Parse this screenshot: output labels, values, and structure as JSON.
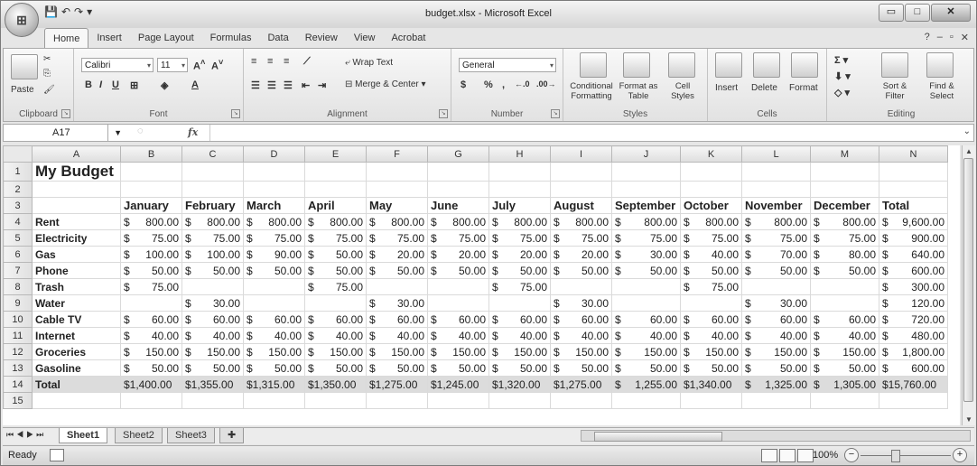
{
  "window": {
    "title": "budget.xlsx - Microsoft Excel",
    "controls": [
      "▭",
      "□",
      "✕"
    ]
  },
  "quick_access": [
    "💾",
    "↶",
    "↷",
    "▾"
  ],
  "ribbon_tabs": [
    "Home",
    "Insert",
    "Page Layout",
    "Formulas",
    "Data",
    "Review",
    "View",
    "Acrobat"
  ],
  "ribbon": {
    "groups": [
      "Clipboard",
      "Font",
      "Alignment",
      "Number",
      "Styles",
      "Cells",
      "Editing"
    ],
    "paste": "Paste",
    "font_name": "Calibri",
    "font_size": "11",
    "wrap_text": "Wrap Text",
    "merge_center": "Merge & Center",
    "number_format": "General",
    "conditional_formatting": "Conditional Formatting",
    "format_as_table": "Format as Table",
    "cell_styles": "Cell Styles",
    "insert": "Insert",
    "delete": "Delete",
    "format": "Format",
    "sort_filter": "Sort & Filter",
    "find_select": "Find & Select",
    "currency": "$",
    "percent": "%",
    "comma": ","
  },
  "formula_bar": {
    "name_box": "A17",
    "formula": ""
  },
  "sheet": {
    "columns": [
      "A",
      "B",
      "C",
      "D",
      "E",
      "F",
      "G",
      "H",
      "I",
      "J",
      "K",
      "L",
      "M",
      "N"
    ],
    "title": "My Budget",
    "months": [
      "January",
      "February",
      "March",
      "April",
      "May",
      "June",
      "July",
      "August",
      "September",
      "October",
      "November",
      "December",
      "Total"
    ],
    "rows": [
      {
        "label": "Rent",
        "values": [
          "800.00",
          "800.00",
          "800.00",
          "800.00",
          "800.00",
          "800.00",
          "800.00",
          "800.00",
          "800.00",
          "800.00",
          "800.00",
          "800.00",
          "9,600.00"
        ]
      },
      {
        "label": "Electricity",
        "values": [
          "75.00",
          "75.00",
          "75.00",
          "75.00",
          "75.00",
          "75.00",
          "75.00",
          "75.00",
          "75.00",
          "75.00",
          "75.00",
          "75.00",
          "900.00"
        ]
      },
      {
        "label": "Gas",
        "values": [
          "100.00",
          "100.00",
          "90.00",
          "50.00",
          "20.00",
          "20.00",
          "20.00",
          "20.00",
          "30.00",
          "40.00",
          "70.00",
          "80.00",
          "640.00"
        ]
      },
      {
        "label": "Phone",
        "values": [
          "50.00",
          "50.00",
          "50.00",
          "50.00",
          "50.00",
          "50.00",
          "50.00",
          "50.00",
          "50.00",
          "50.00",
          "50.00",
          "50.00",
          "600.00"
        ]
      },
      {
        "label": "Trash",
        "values": [
          "75.00",
          "",
          "",
          "75.00",
          "",
          "",
          "75.00",
          "",
          "",
          "75.00",
          "",
          "",
          "300.00"
        ]
      },
      {
        "label": "Water",
        "values": [
          "",
          "30.00",
          "",
          "",
          "30.00",
          "",
          "",
          "30.00",
          "",
          "",
          "30.00",
          "",
          "120.00"
        ]
      },
      {
        "label": "Cable TV",
        "values": [
          "60.00",
          "60.00",
          "60.00",
          "60.00",
          "60.00",
          "60.00",
          "60.00",
          "60.00",
          "60.00",
          "60.00",
          "60.00",
          "60.00",
          "720.00"
        ]
      },
      {
        "label": "Internet",
        "values": [
          "40.00",
          "40.00",
          "40.00",
          "40.00",
          "40.00",
          "40.00",
          "40.00",
          "40.00",
          "40.00",
          "40.00",
          "40.00",
          "40.00",
          "480.00"
        ]
      },
      {
        "label": "Groceries",
        "values": [
          "150.00",
          "150.00",
          "150.00",
          "150.00",
          "150.00",
          "150.00",
          "150.00",
          "150.00",
          "150.00",
          "150.00",
          "150.00",
          "150.00",
          "1,800.00"
        ]
      },
      {
        "label": "Gasoline",
        "values": [
          "50.00",
          "50.00",
          "50.00",
          "50.00",
          "50.00",
          "50.00",
          "50.00",
          "50.00",
          "50.00",
          "50.00",
          "50.00",
          "50.00",
          "600.00"
        ]
      }
    ],
    "total_row": {
      "label": "Total",
      "values": [
        "$1,400.00",
        "$1,355.00",
        "$1,315.00",
        "$1,350.00",
        "$1,275.00",
        "$1,245.00",
        "$1,320.00",
        "$1,275.00",
        "1,255.00",
        "$1,340.00",
        "1,325.00",
        "1,305.00",
        "$15,760.00"
      ]
    },
    "total_dollar_split": [
      false,
      false,
      false,
      false,
      false,
      false,
      false,
      false,
      true,
      false,
      true,
      true,
      false
    ]
  },
  "sheet_tabs": [
    "Sheet1",
    "Sheet2",
    "Sheet3"
  ],
  "status": {
    "ready": "Ready",
    "zoom": "100%"
  }
}
